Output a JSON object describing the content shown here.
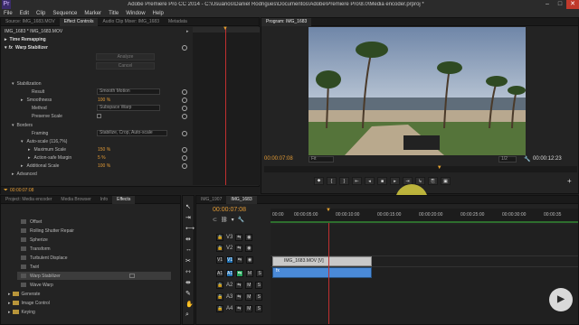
{
  "window": {
    "title": "Adobe Premiere Pro CC 2014 - C:\\Usuários\\Daniel Rodrigues\\Documentos\\Adobe\\Premiere Pro\\8.0\\Media encoder.prproj *",
    "min": "–",
    "max": "□",
    "close": "✕"
  },
  "menu": [
    "File",
    "Edit",
    "Clip",
    "Sequence",
    "Marker",
    "Title",
    "Window",
    "Help"
  ],
  "source_tabs": [
    "Source: IMG_1683.MOV",
    "Effect Controls",
    "Audio Clip Mixer: IMG_1683",
    "Metadata"
  ],
  "effect_controls": {
    "clip_path": "IMG_1683 * IMG_1683.MOV",
    "time_remapping": "Time Remapping",
    "warp_stabilizer": "Warp Stabilizer",
    "analyze": "Analyze",
    "cancel": "Cancel",
    "stabilization": "Stabilization",
    "result_label": "Result",
    "result_value": "Smooth Motion",
    "smoothness_label": "Smoothness",
    "smoothness_value": "100 %",
    "method_label": "Method",
    "method_value": "Subspace Warp",
    "preserve_scale": "Preserve Scale",
    "borders": "Borders",
    "framing_label": "Framing",
    "framing_value": "Stabilize, Crop, Auto-scale",
    "autoscale": "Auto-scale (116,7%)",
    "maxscale_label": "Maximum Scale",
    "maxscale_value": "150 %",
    "actionsafe_label": "Action-safe Margin",
    "actionsafe_value": "5 %",
    "addscale_label": "Additional Scale",
    "addscale_value": "100 %",
    "advanced": "Advanced",
    "timecode": "00:00:07:08"
  },
  "program": {
    "tab": "Program: IMG_1683",
    "timecode_left": "00:00:07:08",
    "fit": "Fit",
    "ratio": "1/2",
    "timecode_right": "00:00:12:23",
    "controls": [
      "⯁",
      "{",
      "}",
      "⇤",
      "◂",
      "■",
      "▸",
      "⇥",
      "↳",
      "⎘",
      "▣",
      "+"
    ],
    "playhead_fraction": 0.56
  },
  "effects_panel": {
    "tabs": [
      "Project: Media encoder",
      "Media Browser",
      "Info",
      "Effects"
    ],
    "items": [
      "Offset",
      "Rolling Shutter Repair",
      "Spherize",
      "Transform",
      "Turbulent Displace",
      "Twirl",
      "Warp Stabilizer",
      "Wave Warp"
    ],
    "folders": [
      "Generate",
      "Image Control",
      "Keying"
    ]
  },
  "timeline": {
    "tabs": [
      "IMG_1907",
      "IMG_1683"
    ],
    "timecode": "00:00:07:08",
    "ruler": [
      "00:00",
      "00:00:05:00",
      "00:00:10:00",
      "00:00:15:00",
      "00:00:20:00",
      "00:00:25:00",
      "00:00:30:00",
      "00:00:35"
    ],
    "video_tracks": [
      "V3",
      "V2",
      "V1"
    ],
    "audio_tracks": [
      "A1",
      "A2",
      "A3",
      "A4"
    ],
    "video_clip": "IMG_1683.MOV [V]",
    "audio_clip": "fx",
    "track_btn_m": "M",
    "track_btn_s": "S"
  },
  "colors": {
    "accent_blue": "#4e9ce0",
    "value_orange": "#e29a35",
    "playhead": "#e2a030",
    "clip_video": "#c9c9c9",
    "clip_audio": "#4a8ad8"
  }
}
